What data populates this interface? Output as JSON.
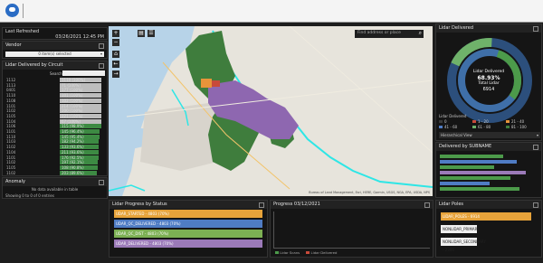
{
  "header": {
    "logo_icon": "app-logo-icon"
  },
  "last_refreshed": {
    "title": "Last Refreshed",
    "value": "03/26/2021 12:45 PM"
  },
  "vendor": {
    "title": "Vendor",
    "selected": "0 item(s) selected"
  },
  "lidar_by_circuit": {
    "title": "Lidar Delivered by Circuit",
    "search_label": "Search",
    "rows": [
      {
        "id": "1112",
        "value": "1110 (100%)",
        "fill": 1.0
      },
      {
        "id": "1113",
        "value": "71 (100%)",
        "fill": 1.0
      },
      {
        "id": "0401",
        "value": "177 (100%)",
        "fill": 1.0
      },
      {
        "id": "1110",
        "value": "101 (100%)",
        "fill": 1.0
      },
      {
        "id": "1108",
        "value": "102 (100%)",
        "fill": 1.0
      },
      {
        "id": "1101",
        "value": "214 (100%)",
        "fill": 1.0
      },
      {
        "id": "1102",
        "value": "200 (100%)",
        "fill": 1.0
      },
      {
        "id": "1105",
        "value": "221 (100%)",
        "fill": 1.0
      },
      {
        "id": "1104",
        "value": "67 (100%)",
        "fill": 1.0
      },
      {
        "id": "1106",
        "value": "115 (98.9%)",
        "fill": 0.99
      },
      {
        "id": "1101",
        "value": "145 (96.4%)",
        "fill": 0.96
      },
      {
        "id": "1110",
        "value": "145 (95.4%)",
        "fill": 0.95
      },
      {
        "id": "1103",
        "value": "182 (94.2%)",
        "fill": 0.94
      },
      {
        "id": "1102",
        "value": "133 (93.6%)",
        "fill": 0.94
      },
      {
        "id": "1104",
        "value": "211 (93.6%)",
        "fill": 0.94
      },
      {
        "id": "1101",
        "value": "176 (92.5%)",
        "fill": 0.93
      },
      {
        "id": "1102",
        "value": "197 (92.1%)",
        "fill": 0.92
      },
      {
        "id": "1105",
        "value": "108 (90.8%)",
        "fill": 0.91
      },
      {
        "id": "1102",
        "value": "203 (89.6%)",
        "fill": 0.9
      }
    ]
  },
  "anomaly": {
    "title": "Anomaly",
    "empty": "No data available in table",
    "footer": "Showing 0 to 0 of 0 entries"
  },
  "map": {
    "search_placeholder": "Find address or place",
    "attribution": "Bureau of Land Management, Esri, HERE, Garmin, USGS, NGA, EPA, USDA, NPS"
  },
  "lidar_delivered": {
    "title": "Lidar Delivered",
    "center_label": "Lidar Delivered",
    "percent": "68.93%",
    "total_label": "Total Lidar",
    "total": "6914",
    "legend_title": "Lidar Delivered",
    "legend": [
      "0",
      "1 - 20",
      "21 - 40",
      "41 - 60",
      "61 - 80",
      "81 - 100"
    ],
    "view_select": "Hierarchical View"
  },
  "subname": {
    "title": "Delivered by SUBNAME"
  },
  "progress_status": {
    "title": "Lidar Progress by Status",
    "bars": [
      {
        "label": "UDAR_STARTED - 4803 (70%)",
        "color": "#e7a33a",
        "fill": 0.7
      },
      {
        "label": "UDAR_QC_DELIVERED - 4803 (70%)",
        "color": "#4f7cc4",
        "fill": 0.7
      },
      {
        "label": "UDAR_QC_DIST - 4803 (70%)",
        "color": "#7cb053",
        "fill": 0.7
      },
      {
        "label": "UDAR_DELIVERED - 4803 (70%)",
        "color": "#9b7ab8",
        "fill": 0.7
      }
    ]
  },
  "progress_date": {
    "title": "Progress 03/12/2021",
    "legend": [
      "Lidar Scans",
      "Lidar Delivered"
    ]
  },
  "lidar_poles": {
    "title": "Lidar Poles",
    "bars": [
      {
        "label": "LIDAR_POLES - 6914",
        "color": "#e7a33a",
        "fill": 1.0
      },
      {
        "label": "NONLIDAR_PRIMARY - 667",
        "color": "#f0f0f0",
        "fill": 0.12
      },
      {
        "label": "NONLIDAR_SECONDARY - 2306",
        "color": "#f0f0f0",
        "fill": 0.36
      }
    ]
  }
}
